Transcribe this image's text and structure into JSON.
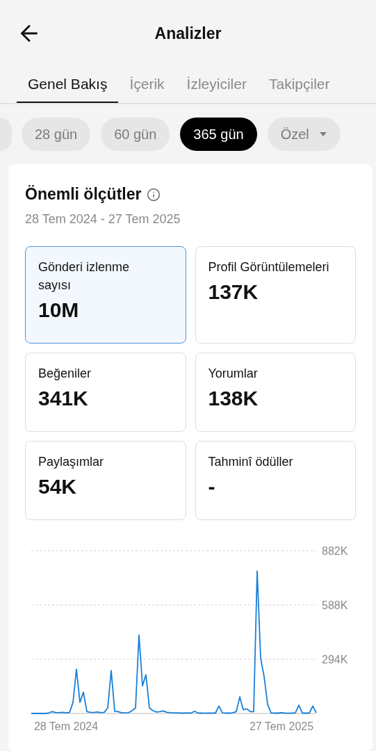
{
  "header": {
    "title": "Analizler"
  },
  "tabs": [
    {
      "label": "Genel Bakış",
      "selected": true
    },
    {
      "label": "İçerik",
      "selected": false
    },
    {
      "label": "İzleyiciler",
      "selected": false
    },
    {
      "label": "Takipçiler",
      "selected": false
    }
  ],
  "periods": [
    {
      "label": "28 gün",
      "selected": false,
      "kind": "chip"
    },
    {
      "label": "60 gün",
      "selected": false,
      "kind": "chip"
    },
    {
      "label": "365 gün",
      "selected": true,
      "kind": "chip"
    },
    {
      "label": "Özel",
      "selected": false,
      "kind": "dropdown"
    }
  ],
  "key_metrics": {
    "title": "Önemli ölçütler",
    "date_range": "28 Tem 2024 - 27 Tem 2025",
    "metrics": [
      {
        "label": "Gönderi izlenme sayısı",
        "value": "10M",
        "selected": true
      },
      {
        "label": "Profil Görüntülemeleri",
        "value": "137K",
        "selected": false
      },
      {
        "label": "Beğeniler",
        "value": "341K",
        "selected": false
      },
      {
        "label": "Yorumlar",
        "value": "138K",
        "selected": false
      },
      {
        "label": "Paylaşımlar",
        "value": "54K",
        "selected": false
      },
      {
        "label": "Tahminî ödüller",
        "value": "-",
        "selected": false
      }
    ],
    "chart_data": {
      "type": "line",
      "ylim": [
        0,
        882
      ],
      "yticks": [
        {
          "value": 294,
          "label": "294K"
        },
        {
          "value": 588,
          "label": "588K"
        },
        {
          "value": 882,
          "label": "882K"
        }
      ],
      "categories": [
        null,
        null,
        null,
        null,
        null,
        null,
        null,
        null,
        null,
        null,
        "28 Tem 2024",
        null,
        null,
        null,
        null,
        null,
        null,
        null,
        null,
        null,
        null,
        null,
        null,
        null,
        null,
        null,
        null,
        null,
        null,
        null,
        null,
        null,
        null,
        null,
        null,
        null,
        null,
        null,
        null,
        null,
        null,
        null,
        null,
        null,
        null,
        null,
        null,
        null,
        null,
        null,
        null,
        null,
        null,
        null,
        null,
        null,
        null,
        null,
        null,
        null,
        null,
        null,
        null,
        null,
        null,
        null,
        null,
        null,
        null,
        null,
        null,
        null,
        "27 Tem 2025",
        null,
        null,
        null,
        null,
        null,
        null,
        null,
        null,
        null,
        null
      ],
      "series": [
        {
          "color": "#1a7fd8",
          "values": [
            0,
            0,
            0,
            0,
            0,
            2,
            10,
            5,
            4,
            6,
            3,
            5,
            60,
            240,
            60,
            115,
            10,
            6,
            5,
            8,
            4,
            6,
            30,
            232,
            12,
            10,
            3,
            3,
            4,
            15,
            30,
            425,
            150,
            210,
            30,
            15,
            8,
            10,
            14,
            6,
            4,
            3,
            3,
            2,
            2,
            3,
            2,
            12,
            2,
            2,
            1,
            2,
            2,
            2,
            40,
            3,
            2,
            2,
            3,
            10,
            90,
            20,
            25,
            10,
            10,
            772,
            300,
            200,
            50,
            3,
            2,
            2,
            4,
            2,
            1,
            2,
            3,
            45,
            2,
            2,
            2,
            40,
            3
          ]
        }
      ]
    }
  }
}
